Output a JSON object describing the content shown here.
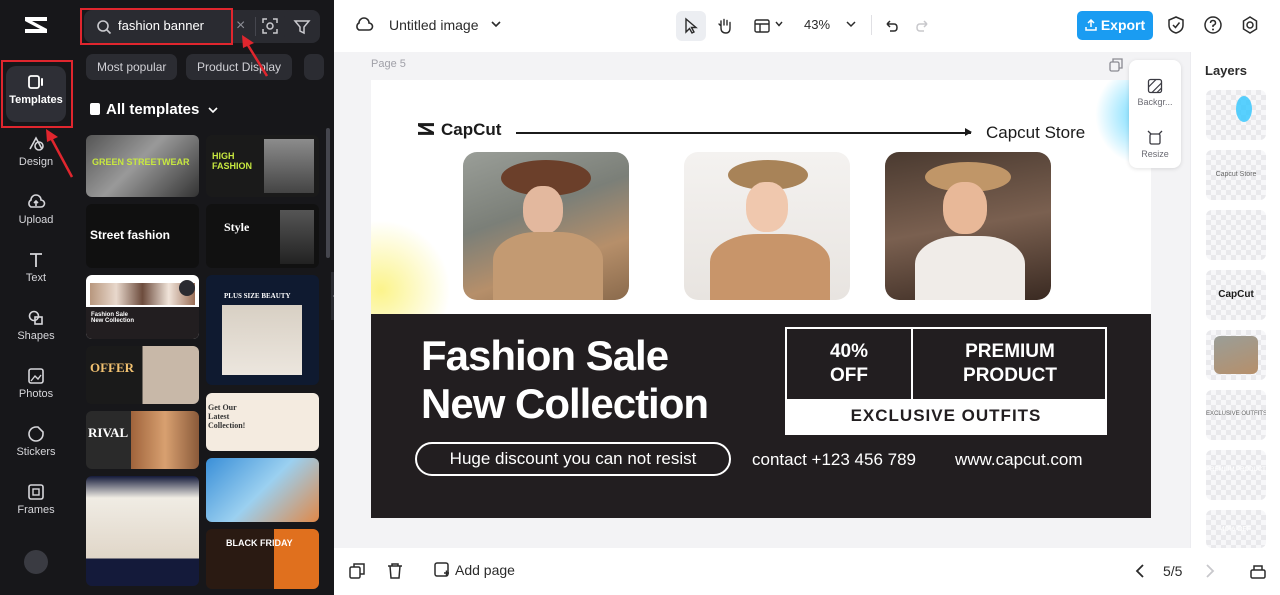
{
  "rail": {
    "items": [
      {
        "label": "Templates"
      },
      {
        "label": "Design"
      },
      {
        "label": "Upload"
      },
      {
        "label": "Text"
      },
      {
        "label": "Shapes"
      },
      {
        "label": "Photos"
      },
      {
        "label": "Stickers"
      },
      {
        "label": "Frames"
      }
    ]
  },
  "panel": {
    "search_value": "fashion banner",
    "clear_icon": "×",
    "chips": [
      "Most popular",
      "Product Display"
    ],
    "section_title": "All templates",
    "thumbs": [
      {
        "text": "GREEN STREETWEAR"
      },
      {
        "text": "HIGH FASHION"
      },
      {
        "text": "Street fashion"
      },
      {
        "text": "Style"
      },
      {
        "text": "Fashion Sale New Collection"
      },
      {
        "text": "PLUS SIZE BEAUTY"
      },
      {
        "text": "OFFER"
      },
      {
        "text": "Get Our Latest Collection!"
      },
      {
        "text": "RIVAL"
      },
      {
        "text": "BLACK FRIDAY"
      }
    ]
  },
  "topbar": {
    "doc_title": "Untitled image",
    "zoom": "43%",
    "export_label": "Export"
  },
  "canvas": {
    "page_label": "Page 5",
    "float_tools": [
      "Backgr...",
      "Resize"
    ]
  },
  "artboard": {
    "logo": "CapCut",
    "store": "Capcut Store",
    "headline_1": "Fashion Sale",
    "headline_2": "New Collection",
    "pill": "Huge discount you can not resist",
    "box_left_1": "40%",
    "box_left_2": "OFF",
    "box_right_1": "PREMIUM",
    "box_right_2": "PRODUCT",
    "box_bottom": "EXCLUSIVE OUTFITS",
    "contact": "contact +123 456 789",
    "website": "www.capcut.com"
  },
  "layers": {
    "title": "Layers",
    "items": [
      "",
      "Capcut Store",
      "",
      "CapCut",
      "",
      "EXCLUSIVE OUTFITS",
      "PREMIUM PRODUCT",
      "40% OFF"
    ]
  },
  "bottombar": {
    "add_page": "Add page",
    "pager": "5/5"
  },
  "colors": {
    "accent": "#1a9cf2",
    "annotation": "#e0262e",
    "banner_dark": "#221e20"
  }
}
